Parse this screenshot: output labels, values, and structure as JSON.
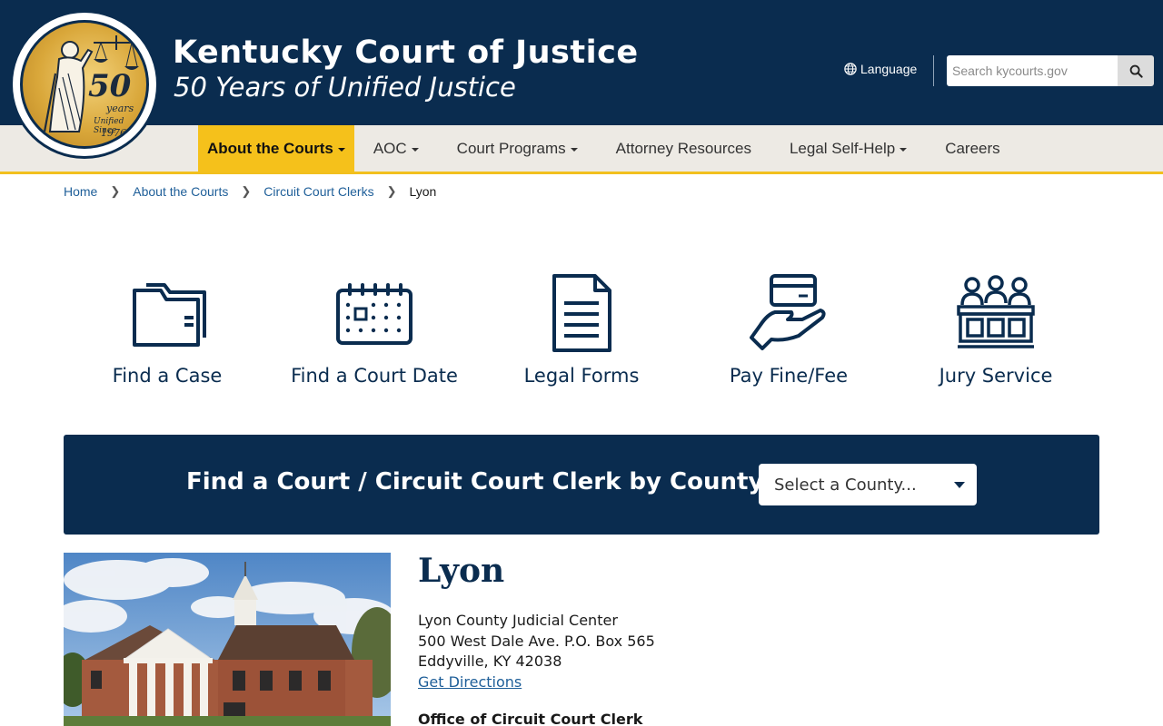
{
  "header": {
    "title": "Kentucky Court of Justice",
    "subtitle": "50 Years of Unified Justice",
    "seal": {
      "ring_text": "KENTUCKY COURT OF JUSTICE",
      "number": "50",
      "years": "years",
      "unified": "Unified Since",
      "year": "1976"
    },
    "language_label": "Language",
    "search_placeholder": "Search kycourts.gov"
  },
  "nav": {
    "items": [
      {
        "label": "About the Courts",
        "dropdown": true,
        "active": true
      },
      {
        "label": "AOC",
        "dropdown": true
      },
      {
        "label": "Court Programs",
        "dropdown": true
      },
      {
        "label": "Attorney Resources",
        "dropdown": false
      },
      {
        "label": "Legal Self-Help",
        "dropdown": true
      },
      {
        "label": "Careers",
        "dropdown": false
      }
    ]
  },
  "breadcrumb": {
    "items": [
      "Home",
      "About the Courts",
      "Circuit Court Clerks"
    ],
    "current": "Lyon"
  },
  "quick_links": [
    {
      "label": "Find a Case",
      "icon": "folder-icon"
    },
    {
      "label": "Find a Court Date",
      "icon": "calendar-icon"
    },
    {
      "label": "Legal Forms",
      "icon": "document-icon"
    },
    {
      "label": "Pay Fine/Fee",
      "icon": "card-hand-icon"
    },
    {
      "label": "Jury Service",
      "icon": "jury-box-icon"
    }
  ],
  "finder": {
    "title": "Find a Court / Circuit Court Clerk by County",
    "select_placeholder": "Select a County..."
  },
  "court": {
    "name": "Lyon",
    "building": "Lyon County Judicial Center",
    "street": "500 West Dale Ave. P.O. Box 565",
    "city": "Eddyville, KY 42038",
    "directions_label": "Get Directions",
    "office_title": "Office of Circuit Court Clerk"
  },
  "colors": {
    "navy": "#0a2c4f",
    "gold": "#f5c11b",
    "nav_bg": "#edeae4",
    "link": "#1f5f99"
  }
}
